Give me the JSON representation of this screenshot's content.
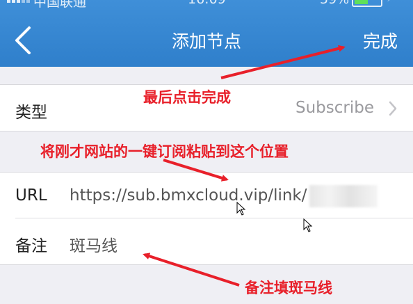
{
  "status_bar": {
    "carrier": "中国联通",
    "time": "16:09",
    "battery": "59%",
    "battery_level": 0.59
  },
  "nav": {
    "title": "添加节点",
    "back_icon": "chevron-left-icon",
    "done_label": "完成"
  },
  "type_row": {
    "label": "类型",
    "value": "Subscribe"
  },
  "url_row": {
    "label": "URL",
    "value": "https://sub.bmxcloud.vip/link/"
  },
  "remark_row": {
    "label": "备注",
    "value": "斑马线"
  },
  "annotations": {
    "done_hint": "最后点击完成",
    "url_hint": "将刚才网站的一键订阅粘贴到这个位置",
    "remark_hint": "备注填斑马线",
    "color": "#e8202a"
  },
  "colors": {
    "nav_bar": "#3a8ad4",
    "background": "#efeff4"
  }
}
